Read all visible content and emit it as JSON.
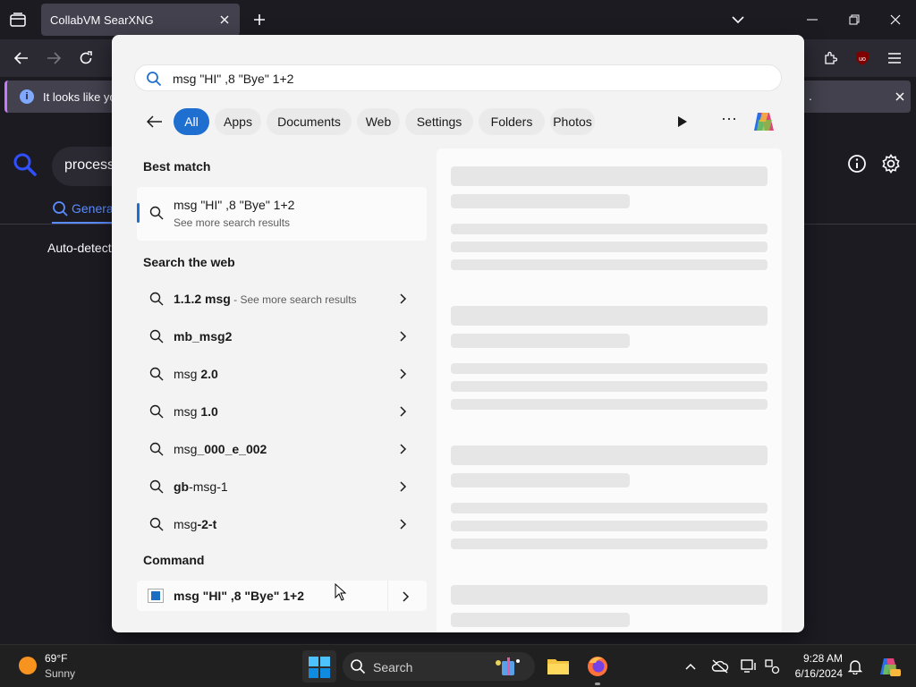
{
  "browser": {
    "tab_title": "CollabVM SearXNG",
    "notification_text": "It looks like you",
    "notification_ellipsis": "."
  },
  "searxng": {
    "query": "process",
    "tab_general": "General",
    "autodetect": "Auto-detect"
  },
  "start_search": {
    "query": "msg \"HI\" ,8 \"Bye\" 1+2",
    "filters": [
      "All",
      "Apps",
      "Documents",
      "Web",
      "Settings",
      "Folders",
      "Photos"
    ],
    "active_filter": "All",
    "best_match_heading": "Best match",
    "best_match": {
      "title": "msg \"HI\" ,8 \"Bye\" 1+2",
      "subtitle": "See more search results"
    },
    "web_heading": "Search the web",
    "web_results": [
      {
        "bold": "1.1.2 msg",
        "normal": "",
        "sub": " - See more search results"
      },
      {
        "bold": "mb_msg2",
        "normal": "",
        "sub": ""
      },
      {
        "normal": "msg ",
        "bold": "2.0",
        "sub": ""
      },
      {
        "normal": "msg ",
        "bold": "1.0",
        "sub": ""
      },
      {
        "normal": "msg",
        "bold": "_000_e_002",
        "sub": ""
      },
      {
        "bold": "gb",
        "normal": "-msg-1",
        "sub": ""
      },
      {
        "normal": "msg",
        "bold": "-2-t",
        "sub": ""
      }
    ],
    "command_heading": "Command",
    "command_text": "msg \"HI\" ,8 \"Bye\" 1+2"
  },
  "taskbar": {
    "weather_temp": "69°F",
    "weather_condition": "Sunny",
    "search_placeholder": "Search",
    "time": "9:28 AM",
    "date": "6/16/2024"
  },
  "colors": {
    "accent": "#1f6fd1",
    "browser_bg": "#1c1b22",
    "panel_bg": "#f3f3f3"
  }
}
